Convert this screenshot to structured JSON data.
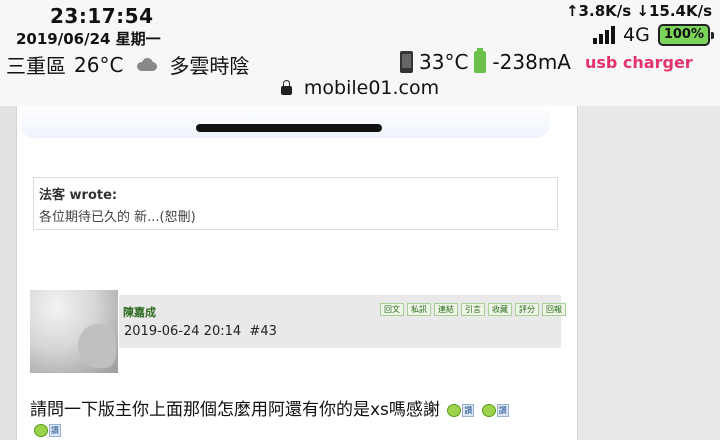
{
  "status_bar": {
    "time": "23:17:54",
    "date": "2019/06/24 星期一",
    "location": "三重區",
    "temperature": "26°C",
    "weather_icon": "cloud-icon",
    "weather": "多雲時陰",
    "upload_speed": "↑3.8K/s",
    "download_speed": "↓15.4K/s",
    "network": "4G",
    "battery_percent": "100%",
    "device_temp": "33°C",
    "current": "-238mA",
    "charger": "usb charger"
  },
  "browser": {
    "url": "mobile01.com"
  },
  "quote": {
    "author": "法客 wrote:",
    "text": "各位期待已久的 新...(恕刪)"
  },
  "post": {
    "username": "陳嘉成",
    "timestamp": "2019-06-24 20:14",
    "post_number": "#43",
    "actions": [
      "回文",
      "私訊",
      "連結",
      "引言",
      "收藏",
      "評分",
      "回報"
    ],
    "content": "請問一下版主你上面那個怎麼用阿還有你的是xs嗎感謝",
    "emoji_label": "讚"
  },
  "colors": {
    "username": "#2c6a1f",
    "charger_text": "#e5326a",
    "battery_fill": "#7cd35a"
  }
}
